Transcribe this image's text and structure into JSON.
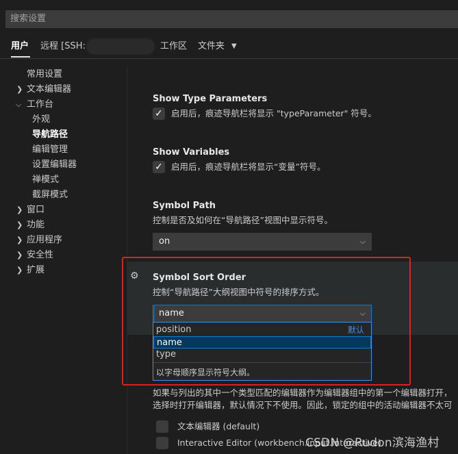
{
  "search": {
    "placeholder": "搜索设置"
  },
  "scope_tabs": {
    "user": "用户",
    "remote": "远程 [SSH:",
    "workspace": "工作区",
    "folder": "文件夹"
  },
  "toc": {
    "common": "常用设置",
    "text_editor": "文本编辑器",
    "workbench": "工作台",
    "appearance": "外观",
    "breadcrumbs": "导航路径",
    "editor_management": "编辑管理",
    "settings_editor": "设置编辑器",
    "zen_mode": "禅模式",
    "screencast_mode": "截屏模式",
    "window": "窗口",
    "features": "功能",
    "application": "应用程序",
    "security": "安全性",
    "extensions": "扩展"
  },
  "settings": {
    "show_type_params": {
      "title": "Show Type Parameters",
      "desc": "启用后，痕迹导航栏将显示 \"typeParameter\" 符号。",
      "checked": true
    },
    "show_variables": {
      "title": "Show Variables",
      "desc": "启用后，痕迹导航栏将显示“变量”符号。",
      "checked": true
    },
    "symbol_path": {
      "title": "Symbol Path",
      "desc": "控制是否及如何在“导航路径”视图中显示符号。",
      "value": "on"
    },
    "symbol_sort_order": {
      "title": "Symbol Sort Order",
      "desc": "控制“导航路径”大纲视图中符号的排序方式。",
      "value": "name",
      "options": [
        "position",
        "name",
        "type"
      ],
      "default_badge": "默认",
      "option_desc": "以字母顺序显示符号大纲。"
    },
    "partial_desc_1": "如果与列出的其中一个类型匹配的编辑器作为编辑器组中的第一个编辑器打开，",
    "partial_desc_2": "选择时打开编辑器，默认情况下不使用。因此，锁定的组中的活动编辑器不太可",
    "editor_items": [
      "文本编辑器 (default)",
      "Interactive Editor (workbench.input.interactive)"
    ]
  },
  "watermark": "CSDN @Rudon滨海渔村",
  "colors": {
    "accent": "#007fd4",
    "annotation": "#e02020"
  }
}
